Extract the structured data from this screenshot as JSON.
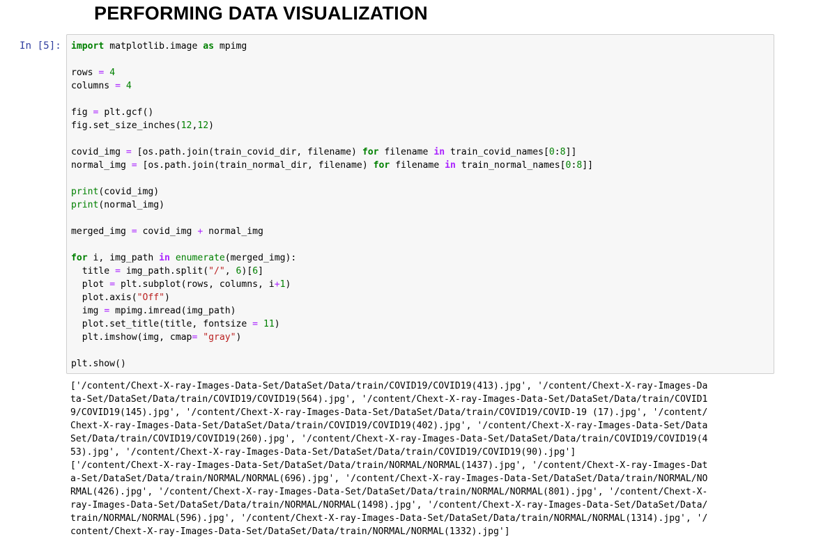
{
  "heading": "PERFORMING DATA VISUALIZATION",
  "cell": {
    "prompt": "In [5]:",
    "code_lines": [
      [
        {
          "t": "import",
          "c": "kw"
        },
        {
          "t": " matplotlib.image ",
          "c": ""
        },
        {
          "t": "as",
          "c": "kw"
        },
        {
          "t": " mpimg",
          "c": ""
        }
      ],
      [],
      [
        {
          "t": "rows ",
          "c": ""
        },
        {
          "t": "=",
          "c": "o"
        },
        {
          "t": " ",
          "c": ""
        },
        {
          "t": "4",
          "c": "num"
        }
      ],
      [
        {
          "t": "columns ",
          "c": ""
        },
        {
          "t": "=",
          "c": "o"
        },
        {
          "t": " ",
          "c": ""
        },
        {
          "t": "4",
          "c": "num"
        }
      ],
      [],
      [
        {
          "t": "fig ",
          "c": ""
        },
        {
          "t": "=",
          "c": "o"
        },
        {
          "t": " plt.gcf()",
          "c": ""
        }
      ],
      [
        {
          "t": "fig.set_size_inches(",
          "c": ""
        },
        {
          "t": "12",
          "c": "num"
        },
        {
          "t": ",",
          "c": ""
        },
        {
          "t": "12",
          "c": "num"
        },
        {
          "t": ")",
          "c": ""
        }
      ],
      [],
      [
        {
          "t": "covid_img ",
          "c": ""
        },
        {
          "t": "=",
          "c": "o"
        },
        {
          "t": " [os.path.join(train_covid_dir, filename) ",
          "c": ""
        },
        {
          "t": "for",
          "c": "kw"
        },
        {
          "t": " filename ",
          "c": ""
        },
        {
          "t": "in",
          "c": "op"
        },
        {
          "t": " train_covid_names[",
          "c": ""
        },
        {
          "t": "0",
          "c": "num"
        },
        {
          "t": ":",
          "c": ""
        },
        {
          "t": "8",
          "c": "num"
        },
        {
          "t": "]]",
          "c": ""
        }
      ],
      [
        {
          "t": "normal_img ",
          "c": ""
        },
        {
          "t": "=",
          "c": "o"
        },
        {
          "t": " [os.path.join(train_normal_dir, filename) ",
          "c": ""
        },
        {
          "t": "for",
          "c": "kw"
        },
        {
          "t": " filename ",
          "c": ""
        },
        {
          "t": "in",
          "c": "op"
        },
        {
          "t": " train_normal_names[",
          "c": ""
        },
        {
          "t": "0",
          "c": "num"
        },
        {
          "t": ":",
          "c": ""
        },
        {
          "t": "8",
          "c": "num"
        },
        {
          "t": "]]",
          "c": ""
        }
      ],
      [],
      [
        {
          "t": "print",
          "c": "builtin"
        },
        {
          "t": "(covid_img)",
          "c": ""
        }
      ],
      [
        {
          "t": "print",
          "c": "builtin"
        },
        {
          "t": "(normal_img)",
          "c": ""
        }
      ],
      [],
      [
        {
          "t": "merged_img ",
          "c": ""
        },
        {
          "t": "=",
          "c": "o"
        },
        {
          "t": " covid_img ",
          "c": ""
        },
        {
          "t": "+",
          "c": "o"
        },
        {
          "t": " normal_img",
          "c": ""
        }
      ],
      [],
      [
        {
          "t": "for",
          "c": "kw"
        },
        {
          "t": " i, img_path ",
          "c": ""
        },
        {
          "t": "in",
          "c": "op"
        },
        {
          "t": " ",
          "c": ""
        },
        {
          "t": "enumerate",
          "c": "builtin"
        },
        {
          "t": "(merged_img):",
          "c": ""
        }
      ],
      [
        {
          "t": "  title ",
          "c": ""
        },
        {
          "t": "=",
          "c": "o"
        },
        {
          "t": " img_path.split(",
          "c": ""
        },
        {
          "t": "\"/\"",
          "c": "str"
        },
        {
          "t": ", ",
          "c": ""
        },
        {
          "t": "6",
          "c": "num"
        },
        {
          "t": ")[",
          "c": ""
        },
        {
          "t": "6",
          "c": "num"
        },
        {
          "t": "]",
          "c": ""
        }
      ],
      [
        {
          "t": "  plot ",
          "c": ""
        },
        {
          "t": "=",
          "c": "o"
        },
        {
          "t": " plt.subplot(rows, columns, i",
          "c": ""
        },
        {
          "t": "+",
          "c": "o"
        },
        {
          "t": "1",
          "c": "num"
        },
        {
          "t": ")",
          "c": ""
        }
      ],
      [
        {
          "t": "  plot.axis(",
          "c": ""
        },
        {
          "t": "\"Off\"",
          "c": "str"
        },
        {
          "t": ")",
          "c": ""
        }
      ],
      [
        {
          "t": "  img ",
          "c": ""
        },
        {
          "t": "=",
          "c": "o"
        },
        {
          "t": " mpimg.imread(img_path)",
          "c": ""
        }
      ],
      [
        {
          "t": "  plot.set_title(title, fontsize ",
          "c": ""
        },
        {
          "t": "=",
          "c": "o"
        },
        {
          "t": " ",
          "c": ""
        },
        {
          "t": "11",
          "c": "num"
        },
        {
          "t": ")",
          "c": ""
        }
      ],
      [
        {
          "t": "  plt.imshow(img, cmap",
          "c": ""
        },
        {
          "t": "=",
          "c": "o"
        },
        {
          "t": " ",
          "c": ""
        },
        {
          "t": "\"gray\"",
          "c": "str"
        },
        {
          "t": ")",
          "c": ""
        }
      ],
      [],
      [
        {
          "t": "plt.show()",
          "c": ""
        }
      ]
    ],
    "output_lines": [
      "['/content/Chext-X-ray-Images-Data-Set/DataSet/Data/train/COVID19/COVID19(413).jpg', '/content/Chext-X-ray-Images-Da",
      "ta-Set/DataSet/Data/train/COVID19/COVID19(564).jpg', '/content/Chext-X-ray-Images-Data-Set/DataSet/Data/train/COVID1",
      "9/COVID19(145).jpg', '/content/Chext-X-ray-Images-Data-Set/DataSet/Data/train/COVID19/COVID-19 (17).jpg', '/content/",
      "Chext-X-ray-Images-Data-Set/DataSet/Data/train/COVID19/COVID19(402).jpg', '/content/Chext-X-ray-Images-Data-Set/Data",
      "Set/Data/train/COVID19/COVID19(260).jpg', '/content/Chext-X-ray-Images-Data-Set/DataSet/Data/train/COVID19/COVID19(4",
      "53).jpg', '/content/Chext-X-ray-Images-Data-Set/DataSet/Data/train/COVID19/COVID19(90).jpg']",
      "['/content/Chext-X-ray-Images-Data-Set/DataSet/Data/train/NORMAL/NORMAL(1437).jpg', '/content/Chext-X-ray-Images-Dat",
      "a-Set/DataSet/Data/train/NORMAL/NORMAL(696).jpg', '/content/Chext-X-ray-Images-Data-Set/DataSet/Data/train/NORMAL/NO",
      "RMAL(426).jpg', '/content/Chext-X-ray-Images-Data-Set/DataSet/Data/train/NORMAL/NORMAL(801).jpg', '/content/Chext-X-",
      "ray-Images-Data-Set/DataSet/Data/train/NORMAL/NORMAL(1498).jpg', '/content/Chext-X-ray-Images-Data-Set/DataSet/Data/",
      "train/NORMAL/NORMAL(596).jpg', '/content/Chext-X-ray-Images-Data-Set/DataSet/Data/train/NORMAL/NORMAL(1314).jpg', '/",
      "content/Chext-X-ray-Images-Data-Set/DataSet/Data/train/NORMAL/NORMAL(1332).jpg']"
    ]
  },
  "colors": {
    "prompt": "#303f9f",
    "keyword": "#008000",
    "string": "#ba2121",
    "operator": "#aa22ff",
    "input_bg": "#f7f7f7",
    "input_border": "#cfcfcf"
  }
}
